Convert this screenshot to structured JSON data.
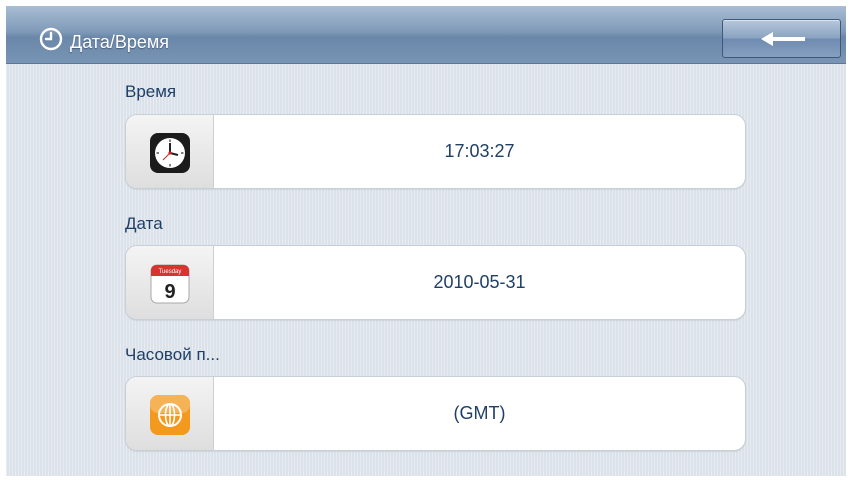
{
  "header": {
    "title": "Дата/Время",
    "icon": "clock-icon",
    "back_icon": "arrow-left-icon"
  },
  "sections": [
    {
      "label": "Время",
      "value": "17:03:27",
      "icon": "clock-app-icon"
    },
    {
      "label": "Дата",
      "value": "2010-05-31",
      "icon": "calendar-icon",
      "icon_text_top": "Tuesday",
      "icon_text_day": "9"
    },
    {
      "label": "Часовой п...",
      "value": "(GMT)",
      "icon": "globe-icon"
    }
  ],
  "colors": {
    "title_bar": "#7f9ab8",
    "content_bg": "#dbe2e9",
    "label_text": "#1f3f66",
    "timezone_icon": "#f39a1e",
    "calendar_header": "#d8342f"
  }
}
